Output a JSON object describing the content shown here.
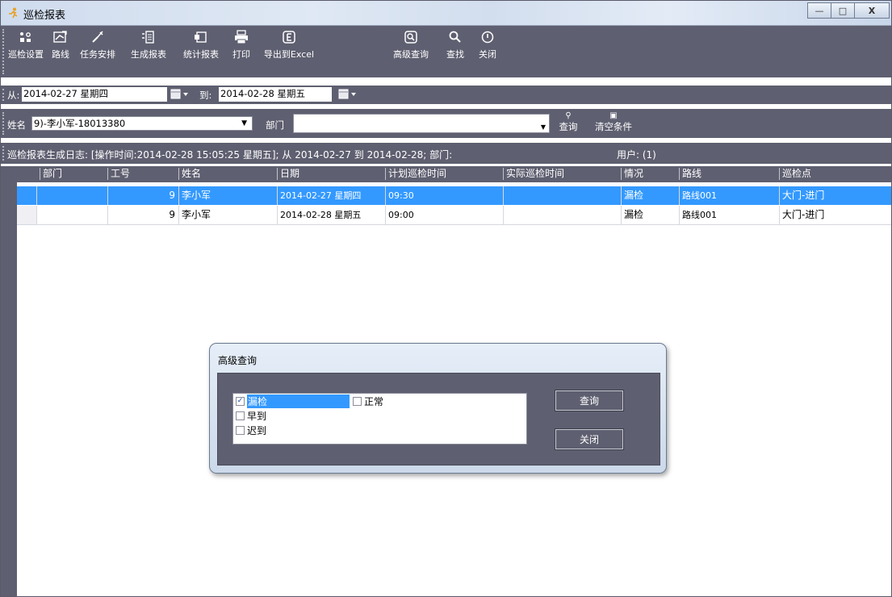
{
  "window": {
    "title": "巡检报表",
    "icon": "person-running-icon",
    "controls": [
      "minimize-icon",
      "maximize-icon",
      "close-icon"
    ]
  },
  "toolbar": {
    "items": [
      {
        "label": "巡检设置",
        "icon": "patrol-settings-icon"
      },
      {
        "label": "路线",
        "icon": "route-icon"
      },
      {
        "label": "任务安排",
        "icon": "task-icon"
      },
      {
        "label": "生成报表",
        "icon": "generate-report-icon"
      },
      {
        "label": "统计报表",
        "icon": "statistics-icon"
      },
      {
        "label": "打印",
        "icon": "printer-icon"
      },
      {
        "label": "导出到Excel",
        "icon": "excel-icon"
      },
      {
        "label": "高级查询",
        "icon": "advanced-search-icon"
      },
      {
        "label": "查找",
        "icon": "search-icon"
      },
      {
        "label": "关闭",
        "icon": "power-icon"
      }
    ]
  },
  "daterange": {
    "from_label": "从:",
    "from_value": "2014-02-27 星期四",
    "to_label": "到:",
    "to_value": "2014-02-28 星期五"
  },
  "filter": {
    "name_label": "姓名",
    "name_value": "9)-李小军-18013380",
    "dept_label": "部门",
    "dept_value": "",
    "query_label": "查询",
    "clear_label": "清空条件"
  },
  "log": {
    "text": "巡检报表生成日志: [操作时间:2014-02-28 15:05:25 星期五]; 从  2014-02-27 到 2014-02-28;  部门:",
    "user": "用户: (1)"
  },
  "table": {
    "columns": [
      "部门",
      "工号",
      "姓名",
      "日期",
      "计划巡检时间",
      "实际巡检时间",
      "情况",
      "路线",
      "巡检点"
    ],
    "rows": [
      [
        "",
        "9",
        "李小军",
        "2014-02-27 星期四",
        "09:30",
        "",
        "漏检",
        "路线001",
        "大门-进门"
      ],
      [
        "",
        "9",
        "李小军",
        "2014-02-28 星期五",
        "09:00",
        "",
        "漏检",
        "路线001",
        "大门-进门"
      ]
    ],
    "selected_row": 0
  },
  "dialog": {
    "title": "高级查询",
    "options": [
      {
        "label": "漏检",
        "checked": true
      },
      {
        "label": "正常",
        "checked": false
      },
      {
        "label": "早到",
        "checked": false
      },
      {
        "label": "迟到",
        "checked": false
      }
    ],
    "query_button": "查询",
    "close_button": "关闭"
  },
  "colors": {
    "panel": "#5e5f70",
    "selection": "#3399ff",
    "header_text": "#ffffff"
  }
}
